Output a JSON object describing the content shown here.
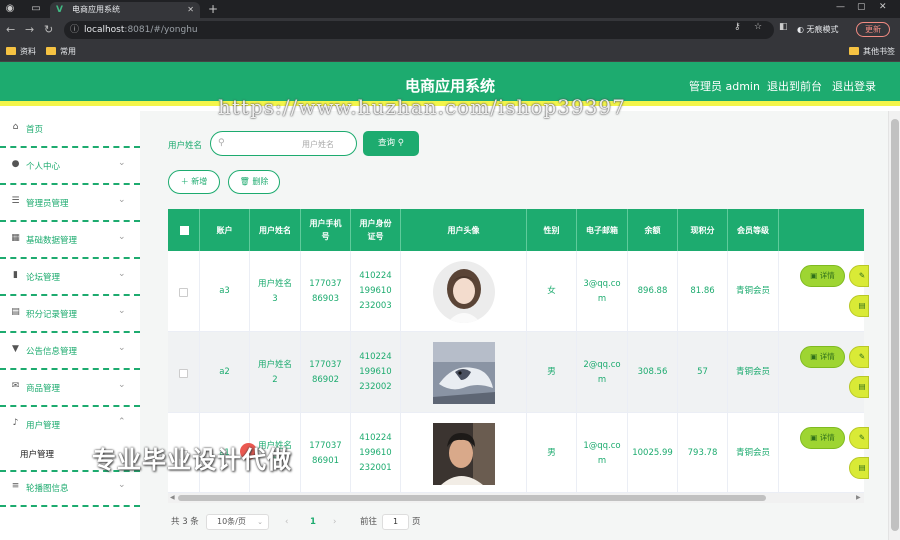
{
  "browser": {
    "tab_title": "电商应用系统",
    "url_host": "localhost",
    "url_rest": ":8081/#/yonghu",
    "incognito_label": "无痕模式",
    "update_label": "更新",
    "bookmarks": [
      "资料",
      "常用"
    ],
    "other_bookmarks": "其他书签"
  },
  "header": {
    "title": "电商应用系统",
    "admin_label": "管理员 admin",
    "frontend_link": "退出到前台",
    "logout_link": "退出登录"
  },
  "overlay": {
    "url_watermark": "https://www.huzhan.com/ishop39397",
    "cn_watermark": "专业毕业设计代做"
  },
  "sidebar": {
    "items": [
      {
        "label": "首页",
        "icon": "home-icon"
      },
      {
        "label": "个人中心",
        "icon": "user-icon"
      },
      {
        "label": "管理员管理",
        "icon": "sliders-icon"
      },
      {
        "label": "基础数据管理",
        "icon": "grid-icon"
      },
      {
        "label": "论坛管理",
        "icon": "chart-icon"
      },
      {
        "label": "积分记录管理",
        "icon": "clipboard-icon"
      },
      {
        "label": "公告信息管理",
        "icon": "pin-icon"
      },
      {
        "label": "商品管理",
        "icon": "mail-icon"
      },
      {
        "label": "用户管理",
        "icon": "mic-icon"
      },
      {
        "label": "轮播图信息",
        "icon": "menu-icon"
      }
    ],
    "submenu": {
      "label": "用户管理"
    }
  },
  "search": {
    "label": "用户姓名",
    "placeholder": "用户姓名",
    "query_button": "查询"
  },
  "actions": {
    "add_label": "新增",
    "delete_label": "删除"
  },
  "table": {
    "columns": [
      "账户",
      "用户姓名",
      "用户手机号",
      "用户身份证号",
      "用户头像",
      "性别",
      "电子邮箱",
      "余额",
      "现积分",
      "会员等级"
    ],
    "rows": [
      {
        "account": "a3",
        "name": "用户姓名3",
        "phone": "17703786903",
        "idcard": "410224199610232003",
        "gender": "女",
        "email": "3@qq.com",
        "balance": "896.88",
        "points": "81.86",
        "level": "青铜会员"
      },
      {
        "account": "a2",
        "name": "用户姓名2",
        "phone": "17703786902",
        "idcard": "410224199610232002",
        "gender": "男",
        "email": "2@qq.com",
        "balance": "308.56",
        "points": "57",
        "level": "青铜会员"
      },
      {
        "account": "a1",
        "name": "用户姓名1",
        "phone": "17703786901",
        "idcard": "410224199610232001",
        "gender": "男",
        "email": "1@qq.com",
        "balance": "10025.99",
        "points": "793.78",
        "level": "青铜会员"
      }
    ],
    "detail_label": "详情"
  },
  "pagination": {
    "total": "共 3 条",
    "page_size": "10条/页",
    "current_page": "1",
    "goto_label": "前往",
    "goto_value": "1",
    "page_suffix": "页"
  },
  "colors": {
    "primary": "#1dab6f",
    "header_stripe": "#f3f54a",
    "action_button": "#9ed532"
  }
}
